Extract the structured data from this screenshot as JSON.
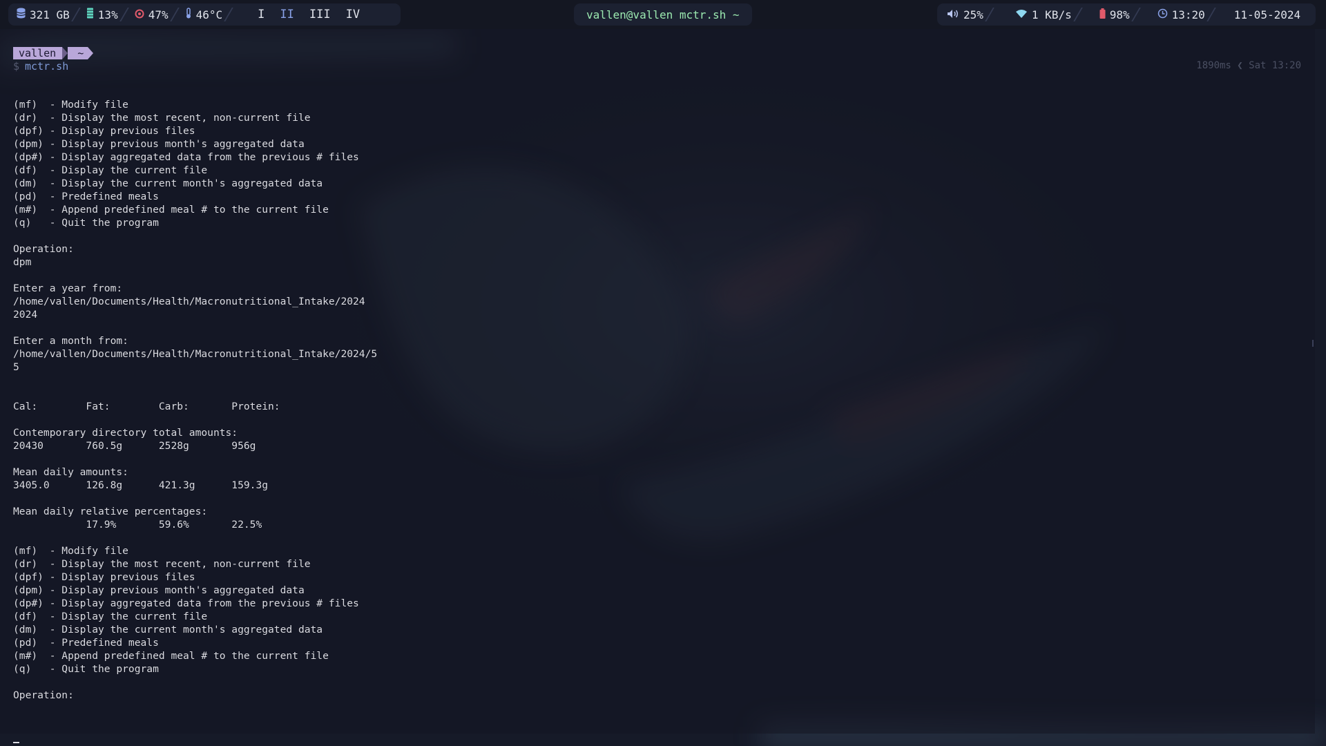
{
  "topbar": {
    "left": {
      "disk": {
        "icon": "database-icon",
        "value": "321 GB"
      },
      "memory": {
        "icon": "memory-icon",
        "value": "13%"
      },
      "cpu": {
        "icon": "cpu-icon",
        "value": "47%"
      },
      "temperature": {
        "icon": "thermometer-icon",
        "value": "46°C"
      },
      "workspaces": [
        {
          "label": "I",
          "active": false
        },
        {
          "label": "II",
          "active": true
        },
        {
          "label": "III",
          "active": false
        },
        {
          "label": "IV",
          "active": false
        }
      ]
    },
    "window_title": "vallen@vallen mctr.sh ~",
    "right": {
      "volume": {
        "icon": "volume-icon",
        "value": "25%"
      },
      "network": {
        "icon": "wifi-icon",
        "value": "1 KB/s"
      },
      "battery": {
        "icon": "battery-icon",
        "value": "98%"
      },
      "clock": {
        "icon": "clock-icon",
        "value": "13:20"
      },
      "date": "11-05-2024"
    },
    "colors": {
      "accent": "#8aa2e8",
      "title": "#9be9b0",
      "battery": "#e05a6a",
      "cpu": "#e05a6a"
    }
  },
  "terminal": {
    "prompt": {
      "user": "vallen",
      "dir": "~"
    },
    "command_symbol": "$",
    "command": "mctr.sh",
    "right_prompt": "1890ms ❮ Sat 13:20",
    "output": "(mf)  - Modify file\n(dr)  - Display the most recent, non-current file\n(dpf) - Display previous files\n(dpm) - Display previous month's aggregated data\n(dp#) - Display aggregated data from the previous # files\n(df)  - Display the current file\n(dm)  - Display the current month's aggregated data\n(pd)  - Predefined meals\n(m#)  - Append predefined meal # to the current file\n(q)   - Quit the program\n\nOperation:\ndpm\n\nEnter a year from:\n/home/vallen/Documents/Health/Macronutritional_Intake/2024\n2024\n\nEnter a month from:\n/home/vallen/Documents/Health/Macronutritional_Intake/2024/5\n5\n\n\nCal:        Fat:        Carb:       Protein:\n\nContemporary directory total amounts:\n20430       760.5g      2528g       956g\n\nMean daily amounts:\n3405.0      126.8g      421.3g      159.3g\n\nMean daily relative percentages:\n            17.9%       59.6%       22.5%\n\n(mf)  - Modify file\n(dr)  - Display the most recent, non-current file\n(dpf) - Display previous files\n(dpm) - Display previous month's aggregated data\n(dp#) - Display aggregated data from the previous # files\n(df)  - Display the current file\n(dm)  - Display the current month's aggregated data\n(pd)  - Predefined meals\n(m#)  - Append predefined meal # to the current file\n(q)   - Quit the program\n\nOperation:"
  }
}
